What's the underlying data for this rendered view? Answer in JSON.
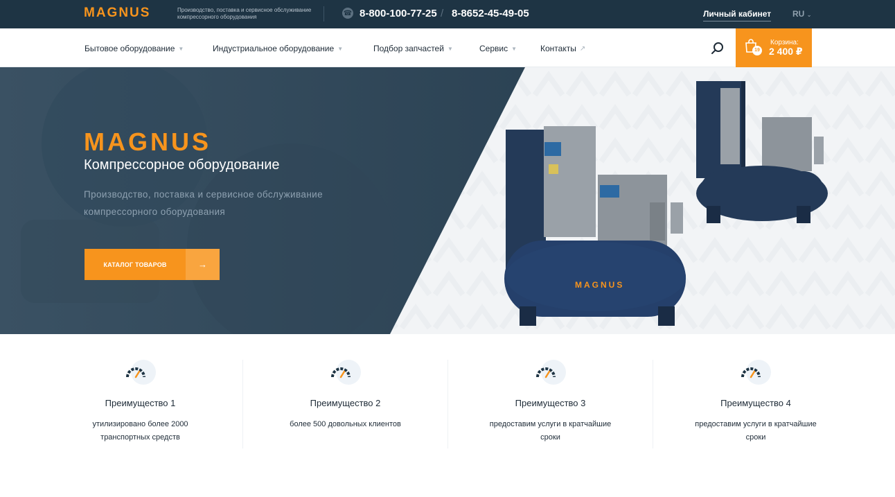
{
  "topbar": {
    "logo": "MAGNUS",
    "tagline": "Производство, поставка и сервисное обслуживание компрессорного оборудования",
    "phone1": "8-800-100-77-25",
    "phone_separator": "/",
    "phone2": "8-8652-45-49-05",
    "account": "Личный кабинет",
    "lang": "RU"
  },
  "nav": {
    "items": [
      {
        "label": "Бытовое оборудование",
        "icon": "chevron-down-icon"
      },
      {
        "label": "Индустриальное оборудование",
        "icon": "chevron-down-icon"
      },
      {
        "label": "Подбор запчастей",
        "icon": "chevron-down-icon"
      },
      {
        "label": "Сервис",
        "icon": "chevron-down-icon"
      },
      {
        "label": "Контакты",
        "icon": "external-arrow-icon"
      }
    ],
    "cart": {
      "label": "Корзина:",
      "total": "2 400 ₽",
      "badge": "19"
    }
  },
  "hero": {
    "logo": "MAGNUS",
    "title": "Компрессорное оборудование",
    "subtitle": "Производство, поставка и сервисное обслуживание компрессорного оборудования",
    "button_label": "КАТАЛОГ ТОВАРОВ",
    "button_arrow": "→"
  },
  "features": [
    {
      "title": "Преимущество 1",
      "text": "утилизировано более 2000 транспортных средств"
    },
    {
      "title": "Преимущество 2",
      "text": "более 500 довольных клиентов"
    },
    {
      "title": "Преимущество 3",
      "text": "предоставим услуги в кратчайшие сроки"
    },
    {
      "title": "Преимущество 4",
      "text": "предоставим услуги в кратчайшие сроки"
    }
  ],
  "colors": {
    "accent": "#f7941d",
    "dark": "#1e3444",
    "hero_bg": "#2b4254"
  }
}
